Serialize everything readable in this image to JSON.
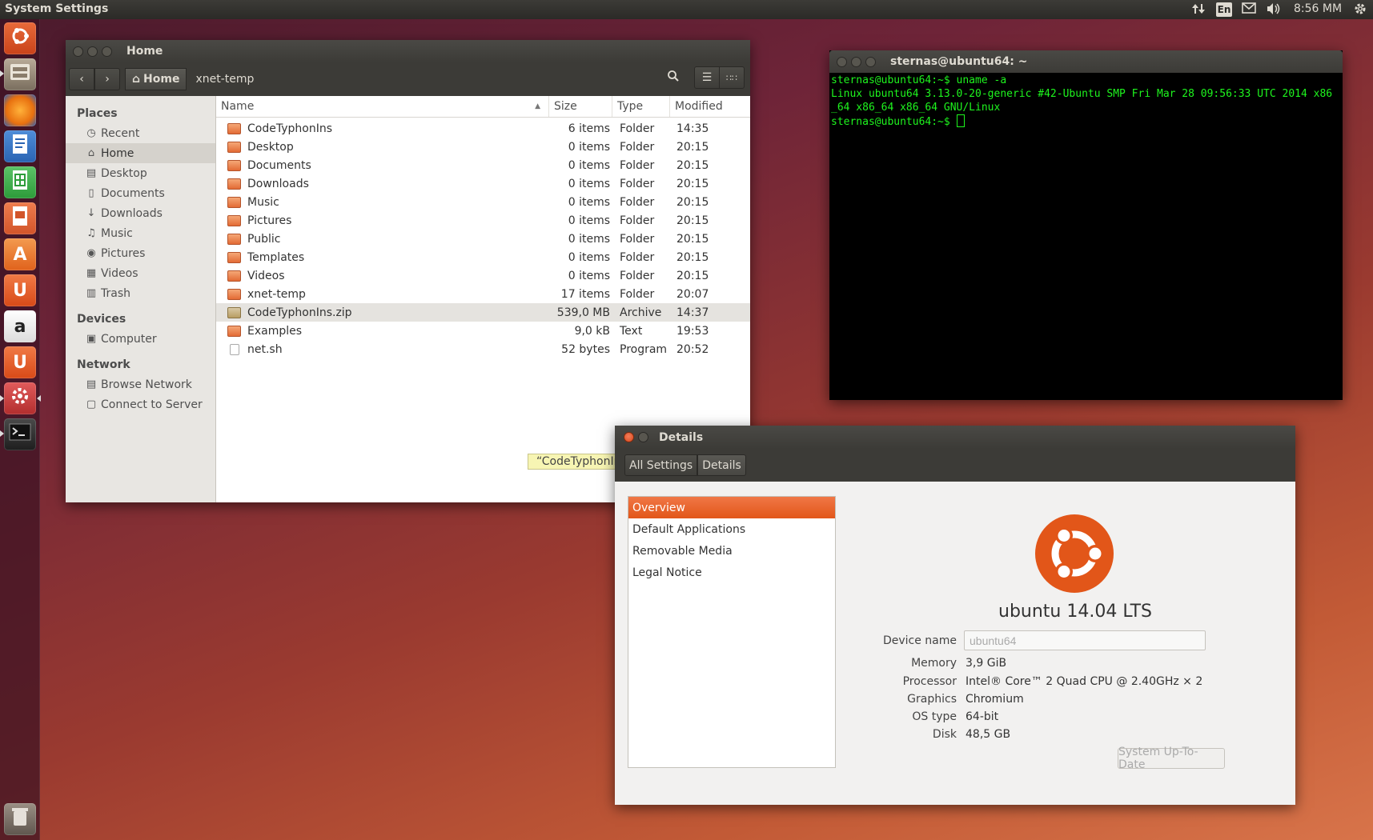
{
  "topbar": {
    "app_title": "System Settings",
    "keyboard_layout": "En",
    "clock": "8:56 MM"
  },
  "launcher": {
    "items": [
      {
        "name": "dash-home",
        "icon": "ubuntu-icon",
        "color": "#e05a2c"
      },
      {
        "name": "files",
        "icon": "file-cabinet-icon",
        "color": "#8a7d6b"
      },
      {
        "name": "firefox",
        "icon": "firefox-icon",
        "color": "#e8700f"
      },
      {
        "name": "libreoffice-writer",
        "icon": "writer-icon",
        "color": "#2a64b3"
      },
      {
        "name": "libreoffice-calc",
        "icon": "calc-icon",
        "color": "#2d9c3a"
      },
      {
        "name": "libreoffice-impress",
        "icon": "impress-icon",
        "color": "#d2552a"
      },
      {
        "name": "software-center",
        "icon": "software-center-icon",
        "color": "#e9772b"
      },
      {
        "name": "ubuntu-one",
        "icon": "ubuntu-one-icon",
        "color": "#e35220"
      },
      {
        "name": "amazon",
        "icon": "amazon-icon",
        "color": "#ffffff"
      },
      {
        "name": "ubuntu-one-music",
        "icon": "ubuntu-one-icon",
        "color": "#e35220"
      },
      {
        "name": "system-settings",
        "icon": "gear-wrench-icon",
        "color": "#c73a3a"
      },
      {
        "name": "terminal",
        "icon": "terminal-icon",
        "color": "#2b2b2b"
      }
    ],
    "trash_icon": "trash-icon"
  },
  "files_window": {
    "title": "Home",
    "breadcrumb": [
      "Home",
      "xnet-temp"
    ],
    "places_header": "Places",
    "places": [
      {
        "label": "Recent",
        "icon": "clock-icon"
      },
      {
        "label": "Home",
        "icon": "home-icon",
        "selected": true
      },
      {
        "label": "Desktop",
        "icon": "folder-icon"
      },
      {
        "label": "Documents",
        "icon": "document-icon"
      },
      {
        "label": "Downloads",
        "icon": "download-icon"
      },
      {
        "label": "Music",
        "icon": "music-icon"
      },
      {
        "label": "Pictures",
        "icon": "camera-icon"
      },
      {
        "label": "Videos",
        "icon": "film-icon"
      },
      {
        "label": "Trash",
        "icon": "trash-icon"
      }
    ],
    "devices_header": "Devices",
    "devices": [
      {
        "label": "Computer",
        "icon": "harddisk-icon"
      }
    ],
    "network_header": "Network",
    "network": [
      {
        "label": "Browse Network",
        "icon": "network-icon"
      },
      {
        "label": "Connect to Server",
        "icon": "server-icon"
      }
    ],
    "columns": {
      "name": "Name",
      "size": "Size",
      "type": "Type",
      "modified": "Modified"
    },
    "files": [
      {
        "name": "CodeTyphonIns",
        "size": "6 items",
        "type": "Folder",
        "modified": "14:35"
      },
      {
        "name": "Desktop",
        "size": "0 items",
        "type": "Folder",
        "modified": "20:15"
      },
      {
        "name": "Documents",
        "size": "0 items",
        "type": "Folder",
        "modified": "20:15"
      },
      {
        "name": "Downloads",
        "size": "0 items",
        "type": "Folder",
        "modified": "20:15"
      },
      {
        "name": "Music",
        "size": "0 items",
        "type": "Folder",
        "modified": "20:15"
      },
      {
        "name": "Pictures",
        "size": "0 items",
        "type": "Folder",
        "modified": "20:15"
      },
      {
        "name": "Public",
        "size": "0 items",
        "type": "Folder",
        "modified": "20:15"
      },
      {
        "name": "Templates",
        "size": "0 items",
        "type": "Folder",
        "modified": "20:15"
      },
      {
        "name": "Videos",
        "size": "0 items",
        "type": "Folder",
        "modified": "20:15"
      },
      {
        "name": "xnet-temp",
        "size": "17 items",
        "type": "Folder",
        "modified": "20:07"
      },
      {
        "name": "CodeTyphonIns.zip",
        "size": "539,0 MB",
        "type": "Archive",
        "modified": "14:37",
        "selected": true
      },
      {
        "name": "Examples",
        "size": "9,0 kB",
        "type": "Text",
        "modified": "19:53"
      },
      {
        "name": "net.sh",
        "size": "52 bytes",
        "type": "Program",
        "modified": "20:52"
      }
    ],
    "tooltip": "“CodeTyphonIns.z"
  },
  "terminal_window": {
    "title": "sternas@ubuntu64: ~",
    "lines": [
      "sternas@ubuntu64:~$ uname -a",
      "Linux ubuntu64 3.13.0-20-generic #42-Ubuntu SMP Fri Mar 28 09:56:33 UTC 2014 x86",
      "_64 x86_64 x86_64 GNU/Linux"
    ],
    "prompt": "sternas@ubuntu64:~$ "
  },
  "details_window": {
    "title": "Details",
    "breadcrumb": [
      "All Settings",
      "Details"
    ],
    "nav": [
      {
        "label": "Overview",
        "selected": true
      },
      {
        "label": "Default Applications"
      },
      {
        "label": "Removable Media"
      },
      {
        "label": "Legal Notice"
      }
    ],
    "os_name": "ubuntu 14.04 LTS",
    "device_name_label": "Device name",
    "device_name_value": "ubuntu64",
    "memory_label": "Memory",
    "memory_value": "3,9 GiB",
    "processor_label": "Processor",
    "processor_value": "Intel® Core™ 2 Quad CPU @ 2.40GHz × 2",
    "graphics_label": "Graphics",
    "graphics_value": "Chromium",
    "ostype_label": "OS type",
    "ostype_value": "64-bit",
    "disk_label": "Disk",
    "disk_value": "48,5 GB",
    "update_button": "System Up-To-Date"
  },
  "colors": {
    "accent_orange": "#e25619",
    "terminal_green": "#1ef51e",
    "panel_dark": "#3c3b37"
  }
}
